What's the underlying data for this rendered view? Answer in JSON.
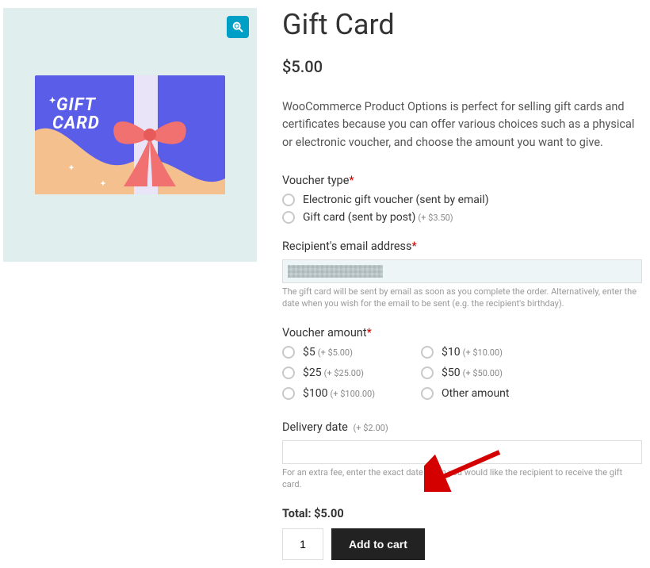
{
  "product": {
    "title": "Gift Card",
    "price": "$5.00",
    "description": "WooCommerce Product Options is perfect for selling gift cards and certificates because you can offer various choices such as a physical or electronic voucher, and choose the amount you want to give.",
    "image_text_line1": "GIFT",
    "image_text_line2": "CARD"
  },
  "voucher_type": {
    "label": "Voucher type",
    "options": [
      {
        "label": "Electronic gift voucher (sent by email)",
        "price": ""
      },
      {
        "label": "Gift card (sent by post)",
        "price": "(+ $3.50)"
      }
    ]
  },
  "email": {
    "label": "Recipient's email address",
    "helper": "The gift card will be sent by email as soon as you complete the order. Alternatively, enter the date when you wish for the email to be sent (e.g. the recipient's birthday)."
  },
  "amount": {
    "label": "Voucher amount",
    "options": [
      {
        "label": "$5",
        "price": "(+ $5.00)"
      },
      {
        "label": "$10",
        "price": "(+ $10.00)"
      },
      {
        "label": "$25",
        "price": "(+ $25.00)"
      },
      {
        "label": "$50",
        "price": "(+ $50.00)"
      },
      {
        "label": "$100",
        "price": "(+ $100.00)"
      },
      {
        "label": "Other amount",
        "price": ""
      }
    ]
  },
  "delivery": {
    "label": "Delivery date",
    "price": "(+ $2.00)",
    "helper": "For an extra fee, enter the exact date when you would like the recipient to receive the gift card."
  },
  "total": {
    "label": "Total:",
    "value": "$5.00"
  },
  "cart": {
    "qty": 1,
    "button": "Add to cart"
  }
}
